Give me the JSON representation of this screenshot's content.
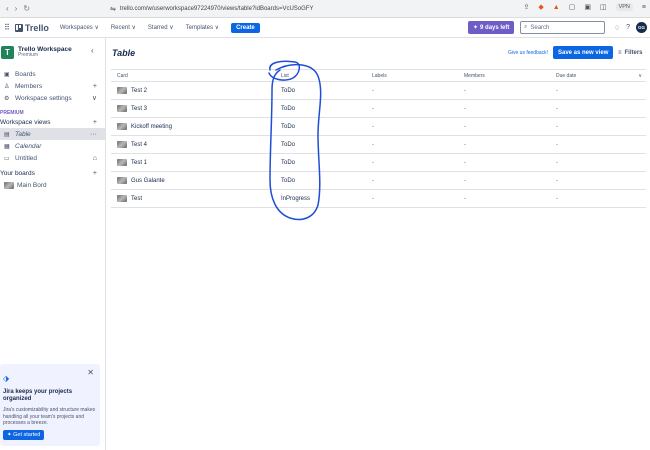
{
  "browser": {
    "url": "trello.com/w/userworkspace97224970/views/table?idBoards=VcUSoGFY",
    "vpn_label": "VPN"
  },
  "header": {
    "logo": "Trello",
    "menu": [
      "Workspaces ∨",
      "Recent ∨",
      "Starred ∨",
      "Templates ∨"
    ],
    "create": "Create",
    "trial": "9 days left",
    "search_placeholder": "Search",
    "avatar": "GG"
  },
  "sidebar": {
    "workspace_initial": "T",
    "workspace_name": "Trello Workspace",
    "workspace_plan": "Premium",
    "boards": "Boards",
    "members": "Members",
    "workspace_settings": "Workspace settings",
    "premium_label": "PREMIUM",
    "views_heading": "Workspace views",
    "views": [
      "Table",
      "Calendar",
      "Untitled"
    ],
    "your_boards": "Your boards",
    "board_name": "Main Bord",
    "promo": {
      "title": "Jira keeps your projects organized",
      "body": "Jira's customizability and structure makes handling all your team's projects and processes a breeze.",
      "button": "Get started"
    }
  },
  "main": {
    "title": "Table",
    "feedback": "Give us feedback!",
    "save_view": "Save as new view",
    "filters": "Filters",
    "columns": [
      "Card",
      "List",
      "Labels",
      "Members",
      "Due date"
    ],
    "empty": "-",
    "rows": [
      {
        "card": "Test 2",
        "list": "ToDo"
      },
      {
        "card": "Test 3",
        "list": "ToDo"
      },
      {
        "card": "Kickoff meeting",
        "list": "ToDo"
      },
      {
        "card": "Test 4",
        "list": "ToDo"
      },
      {
        "card": "Test 1",
        "list": "ToDo"
      },
      {
        "card": "Gus Galante",
        "list": "ToDo"
      },
      {
        "card": "Test",
        "list": "InProgress"
      }
    ]
  },
  "colors": {
    "accent": "#0c66e4",
    "trial": "#6e5dc6",
    "workspace": "#1f845a",
    "annotation": "#1d4ed8"
  }
}
